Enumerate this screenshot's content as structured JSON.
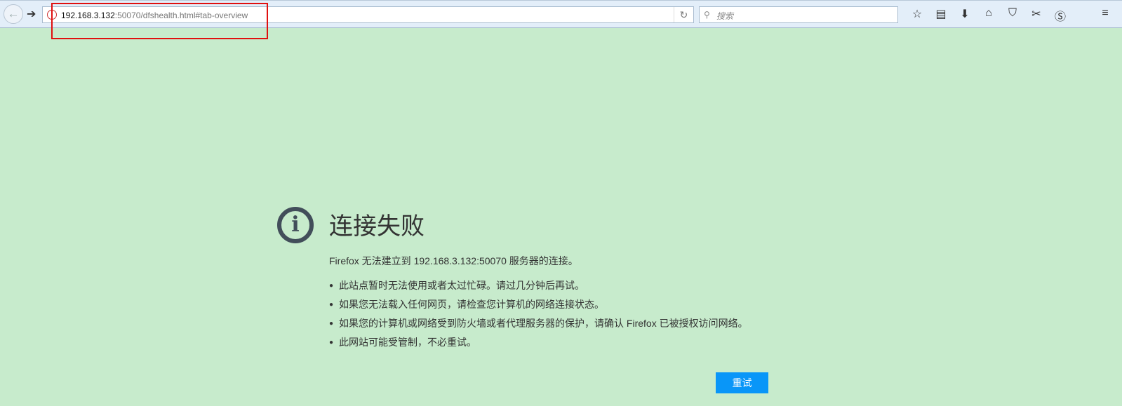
{
  "toolbar": {
    "url_host": "192.168.3.132",
    "url_rest": ":50070/dfshealth.html#tab-overview",
    "search_placeholder": "搜索"
  },
  "error": {
    "title": "连接失败",
    "description": "Firefox 无法建立到 192.168.3.132:50070 服务器的连接。",
    "bullets": [
      "此站点暂时无法使用或者太过忙碌。请过几分钟后再试。",
      "如果您无法载入任何网页，请检查您计算机的网络连接状态。",
      "如果您的计算机或网络受到防火墙或者代理服务器的保护，请确认 Firefox 已被授权访问网络。",
      "此网站可能受管制，不必重试。"
    ],
    "retry_label": "重试"
  }
}
